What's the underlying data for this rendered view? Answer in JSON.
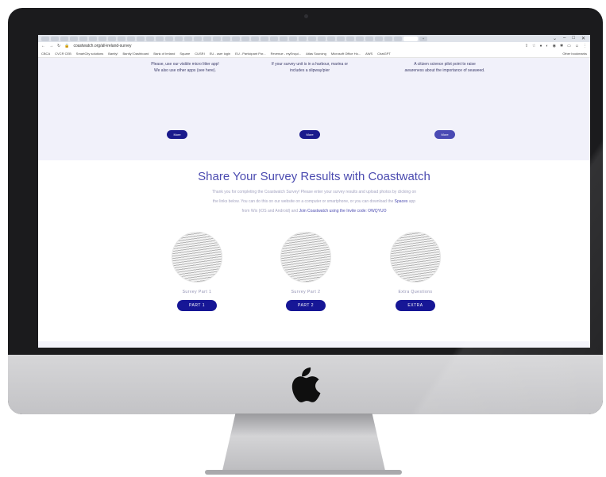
{
  "browser": {
    "url": "coastwatch.org/all-ireland-survey",
    "bookmarks": [
      "CBCA",
      "CVCR CEB",
      "SmartCity solutions",
      "Bantly!",
      "Bantly! Dashboard",
      "Bank of Ireland",
      "Square",
      "CUSRI",
      "EU - user login",
      "EU - Participant Por...",
      "Revenue - myEnqui...",
      "Atlas Sourcing",
      "Microsoft Office Ho...",
      "AWS",
      "ChatGPT"
    ],
    "other_bookmarks": "Other bookmarks"
  },
  "top_section": {
    "columns": [
      {
        "line1": "Please, use our visible micro litter app!",
        "line2": "We also use other apps (see here).",
        "button": "More"
      },
      {
        "line1": "If your survey unit is in a harbour, marina or",
        "line2": "includes a slipway/pier",
        "button": "More"
      },
      {
        "line1": "A citizen science pilot point to raise",
        "line2": "awareness about the importance of seaweed.",
        "button": "More"
      }
    ]
  },
  "share_section": {
    "title": "Share Your Survey Results with Coastwatch",
    "desc_line1": "Thank you for completing the Coastwatch Survey! Please enter your survey results and upload photos by clicking on",
    "desc_line2_a": "the links below. You can do this on our website on a computer or smartphone, or you can download the ",
    "desc_line2_link": "Spaces",
    "desc_line2_b": " app",
    "desc_line3_a": "from Wix (iOS and Android) and ",
    "desc_line3_link": "Join Coastwatch using the Invite code: OWQYUO",
    "cards": [
      {
        "caption": "Survey Part 1",
        "button": "PART 1"
      },
      {
        "caption": "Survey Part 2",
        "button": "PART 2"
      },
      {
        "caption": "Extra Questions",
        "button": "EXTRA"
      }
    ]
  },
  "colors": {
    "accent": "#161696",
    "title": "#4b4bb0",
    "band": "#f1f1fa"
  }
}
